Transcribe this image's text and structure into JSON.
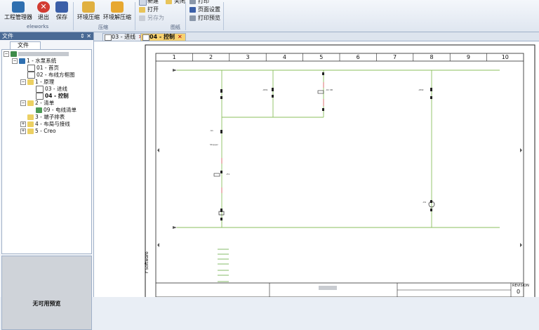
{
  "ribbon": {
    "buttons": [
      {
        "label": "工程管理器",
        "icon": "project-manager-icon"
      },
      {
        "label": "退出",
        "icon": "exit-icon"
      },
      {
        "label": "保存",
        "icon": "save-icon"
      },
      {
        "label": "环境压缩",
        "icon": "compress-icon"
      },
      {
        "label": "环境解压缩",
        "icon": "decompress-icon"
      }
    ],
    "group_eleworks": "eleworks",
    "group_compress": "压缩",
    "group_drawing": "图纸",
    "drawing_items": [
      "新建",
      "打开",
      "另存为"
    ],
    "close_label": "关闭",
    "print_items": [
      "打印",
      "页面设置",
      "打印预览"
    ]
  },
  "panel": {
    "title": "文件",
    "controls": "⇕ ✕",
    "tab_label": "文件",
    "tree": [
      {
        "label": "1 - 水泵系统"
      },
      {
        "label": "01 - 首页"
      },
      {
        "label": "02 - 布线方框图"
      },
      {
        "label": "1 - 原理"
      },
      {
        "label": "03 - 进线"
      },
      {
        "label": "04 - 控制"
      },
      {
        "label": "2 - 清单"
      },
      {
        "label": "09 - 电线清单"
      },
      {
        "label": "3 - 端子排表"
      },
      {
        "label": "4 - 布局与接线"
      },
      {
        "label": "5 - Creo"
      }
    ],
    "preview_text": "无可用预览"
  },
  "tabs": [
    {
      "label": "03 - 进线",
      "close": "✕"
    },
    {
      "label": "04 - 控制",
      "close": "✕"
    }
  ],
  "sheet": {
    "columns": [
      "1",
      "2",
      "3",
      "4",
      "5",
      "6",
      "7",
      "8",
      "9",
      "10"
    ],
    "revision_label": "REVISION",
    "revision_value": "0",
    "side_label": "r Software"
  }
}
